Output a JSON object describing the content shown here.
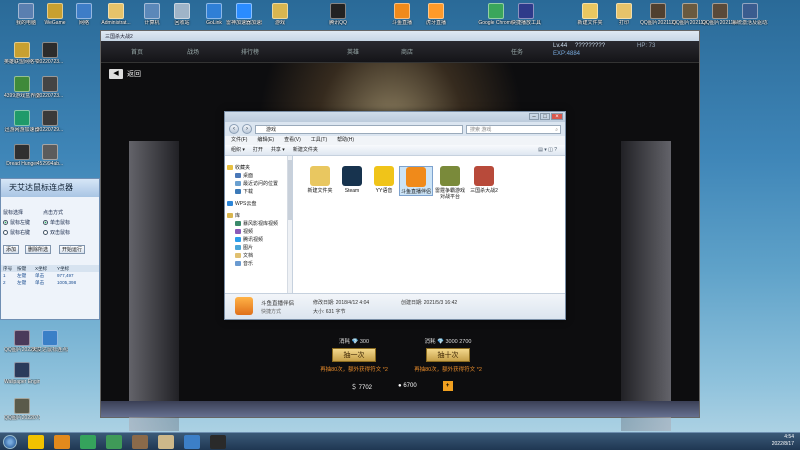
{
  "desktop_icons": [
    {
      "label": "我的电脑",
      "color": "#5a7fb0"
    },
    {
      "label": "WeGame",
      "color": "#c8a030"
    },
    {
      "label": "网络",
      "color": "#3e7dc7"
    },
    {
      "label": "Administrat...",
      "color": "#e6c36a"
    },
    {
      "label": "计算机",
      "color": "#5b88b9"
    },
    {
      "label": "回收站",
      "color": "#9fb4c8"
    },
    {
      "label": "GoLink",
      "color": "#2f7fd6"
    },
    {
      "label": "雷神加速器加速器",
      "color": "#2a8cff"
    },
    {
      "label": "游戏",
      "color": "#d9b64f"
    },
    {
      "label": "腾讯QQ",
      "color": "#222222"
    },
    {
      "label": "斗鱼直播",
      "color": "#f08a1a"
    },
    {
      "label": "虎牙直播",
      "color": "#ff9a2a"
    },
    {
      "label": "Google Chrome",
      "color": "#3aa65b"
    },
    {
      "label": "快捷播放工具",
      "color": "#2e3a8a"
    },
    {
      "label": "新建文件夹",
      "color": "#e9c760"
    },
    {
      "label": "打印",
      "color": "#e6c36a"
    },
    {
      "label": "QQ图片2021122...",
      "color": "#50402f"
    },
    {
      "label": "QQ图片2021120...",
      "color": "#6a5a3f"
    },
    {
      "label": "QQ图片2021120...",
      "color": "#5a4a3a"
    },
    {
      "label": "系统激活及驱动工具",
      "color": "#3a5c8f"
    },
    {
      "label": "英雄联盟网络平台",
      "color": "#c8a030"
    },
    {
      "label": "20220723...",
      "color": "#2c2c2c"
    },
    {
      "label": "4399游戏盒界面功能",
      "color": "#3f8a3a"
    },
    {
      "label": "20220723...",
      "color": "#444444"
    },
    {
      "label": "迅游网游加速器",
      "color": "#1f9a6a"
    },
    {
      "label": "20220729...",
      "color": "#3a3a3a"
    },
    {
      "label": "Dread Hunger",
      "color": "#2f2f2f"
    },
    {
      "label": "452994ab...",
      "color": "#5c5c5c"
    },
    {
      "label": "QQ图片20220527...",
      "color": "#4a3a5a"
    },
    {
      "label": "天艾达鼠标连点器",
      "color": "#3a7fc7"
    },
    {
      "label": "Wallpaper Engine：...",
      "color": "#2b3b5b"
    },
    {
      "label": "QQ图片20220716...",
      "color": "#5a5a4a"
    }
  ],
  "game": {
    "window_title": "三国杀大战2",
    "nav": [
      "首页",
      "战场",
      "排行榜",
      "",
      "英雄",
      "商店",
      "",
      "任务"
    ],
    "player": {
      "level": "Lv.44",
      "name": "?????????",
      "hp_text": "HP: 73",
      "exp_text": "EXP:4884"
    },
    "back_label": "返回",
    "draw_once": {
      "cost": "消耗 💎 300",
      "button": "抽一次",
      "bonus": "再抽80次，额外获得符文 *2"
    },
    "draw_ten": {
      "cost": "消耗 💎 3000 2700",
      "button": "抽十次",
      "bonus": "再抽80次，额外获得符文 *2"
    },
    "currency_a": "7702",
    "currency_b": "6700",
    "currency_plus": "+"
  },
  "explorer": {
    "address_path": "游戏",
    "search_placeholder": "搜索 游戏",
    "menu": [
      "文件(F)",
      "编辑(E)",
      "查看(V)",
      "工具(T)",
      "帮助(H)"
    ],
    "toolbar": [
      "组织 ▾",
      "打开",
      "共享 ▾",
      "新建文件夹"
    ],
    "sidebar": [
      {
        "label": "收藏夹",
        "color": "#e8c040",
        "head": true
      },
      {
        "label": "桌面",
        "color": "#4a78b8"
      },
      {
        "label": "最近访问的位置",
        "color": "#6aa0d0"
      },
      {
        "label": "下载",
        "color": "#3c7ab8"
      },
      {
        "label": "WPS云盘",
        "color": "#2d86d8",
        "head": true
      },
      {
        "label": "库",
        "color": "#d9b64f",
        "head": true
      },
      {
        "label": "暴风影视库视频",
        "color": "#3a8a6a"
      },
      {
        "label": "视频",
        "color": "#8a5ab8"
      },
      {
        "label": "腾讯视频",
        "color": "#2b9dea"
      },
      {
        "label": "图片",
        "color": "#4aa5d8"
      },
      {
        "label": "文档",
        "color": "#e0c070"
      },
      {
        "label": "音乐",
        "color": "#6a9ad0"
      }
    ],
    "files": [
      {
        "name": "新建文件夹",
        "color": "#e9c760"
      },
      {
        "name": "Steam",
        "color": "#17334e"
      },
      {
        "name": "YY语音",
        "color": "#f0c419"
      },
      {
        "name": "斗鱼直播伴侣",
        "color": "#f08a1a",
        "selected": true
      },
      {
        "name": "雷霆争霸游戏对战平台",
        "color": "#7a8a3a"
      },
      {
        "name": "三国杀大战2",
        "color": "#b84a3a"
      }
    ],
    "details": {
      "name": "斗鱼直播伴侣",
      "type": "快捷方式",
      "modified": "修改日期: 2018/4/12 4:04",
      "size": "大小: 631 字节",
      "created": "创建日期: 2021/5/3 16:42"
    }
  },
  "clicker": {
    "title": "天艾达鼠标连点器",
    "group_mouse": "鼠标选择",
    "opt_left": "鼠标左键",
    "opt_right": "鼠标右键",
    "group_mode": "点击方式",
    "opt_single": "单击鼠标",
    "opt_double": "双击鼠标",
    "btn_a": "添加",
    "btn_b": "删除所选",
    "btn_c": "开始运行",
    "headers": [
      "序号",
      "按键",
      "X坐标",
      "Y坐标"
    ],
    "rows": [
      [
        "1",
        "左键",
        "单击",
        "977,497"
      ],
      [
        "2",
        "左键",
        "单击",
        "1005,398"
      ]
    ]
  },
  "taskbar": {
    "apps": [
      "#f2c200",
      "#e28a1c",
      "#35a35c",
      "#3f9a58",
      "#8a6a4a",
      "#cdb88a",
      "#3c7fc7",
      "#2a2a2a"
    ],
    "time": "4:54",
    "date": "2022/8/17"
  }
}
